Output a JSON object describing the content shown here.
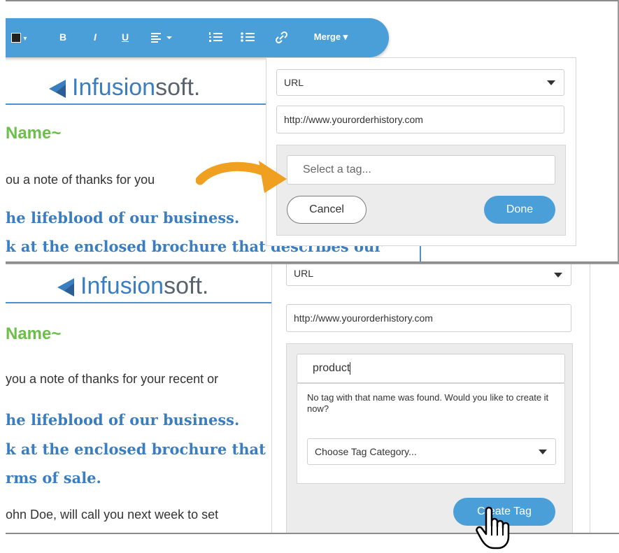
{
  "toolbar": {
    "bold": "B",
    "italic": "I",
    "underline": "U",
    "merge_label": "Merge ▾"
  },
  "email": {
    "logo_brand_bold": "Infusion",
    "logo_brand_light": "soft.",
    "salutation": "Name~",
    "line_thanks_top": "ou a note of thanks for you",
    "line_thanks_bottom": "you a note of thanks for your recent or",
    "lifeblood": "he lifeblood of our business.",
    "brochure_top": "k at the enclosed brochure that describes our",
    "brochure_bottom": "k at the enclosed brochure tha",
    "terms": "rms of sale.",
    "followup": "ohn Doe, will call you next week to set"
  },
  "link_popover": {
    "type_value": "URL",
    "url_value": "http://www.yourorderhistory.com",
    "tag_placeholder": "Select a tag...",
    "cancel_label": "Cancel",
    "done_label": "Done"
  },
  "tag_popover": {
    "type_value": "URL",
    "url_value": "http://www.yourorderhistory.com",
    "tag_input_value": "product",
    "not_found_message": "No tag with that name was found. Would you like to create it now?",
    "category_placeholder": "Choose Tag Category...",
    "create_tag_label": "Create Tag"
  },
  "colors": {
    "toolbar_bg": "#4a9fd9",
    "brand_blue": "#3a7dc0",
    "salutation_green": "#6cc04a",
    "arrow_orange": "#f0a020",
    "button_blue": "#4a9fd9"
  },
  "icons": [
    "color-swatch-icon",
    "bold-icon",
    "italic-icon",
    "underline-icon",
    "align-icon",
    "numbered-list-icon",
    "bullet-list-icon",
    "link-icon",
    "chevron-down-icon",
    "orange-arrow-icon",
    "hand-cursor-icon"
  ]
}
